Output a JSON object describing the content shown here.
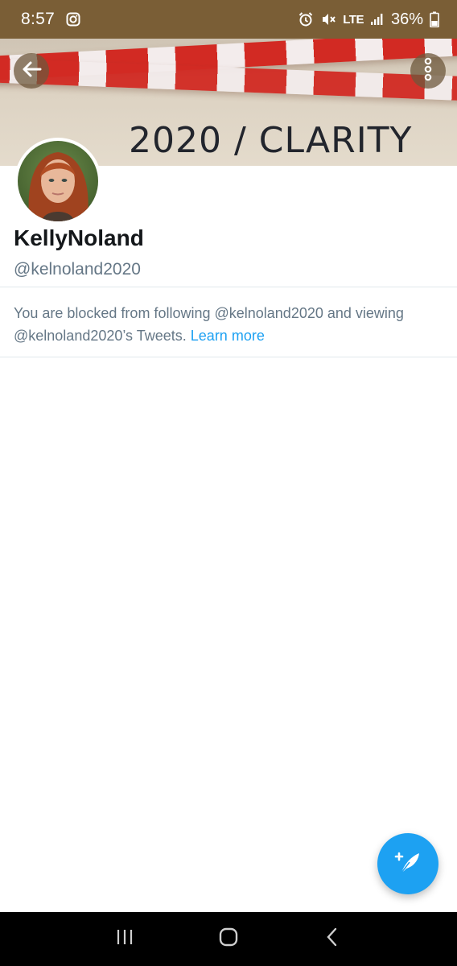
{
  "status_bar": {
    "time": "8:57",
    "battery": "36%",
    "network": "LTE",
    "icons": [
      "instagram-icon",
      "alarm-icon",
      "mute-icon",
      "signal-icon",
      "battery-icon"
    ]
  },
  "banner": {
    "text": "2020 / CLARITY",
    "icons": {
      "back": "back-arrow-icon",
      "more": "more-vertical-icon"
    }
  },
  "profile": {
    "display_name": "KellyNoland",
    "handle": "@kelnoland2020"
  },
  "notice": {
    "text": "You are blocked from following @kelnoland2020 and viewing @kelnoland2020’s Tweets.",
    "link": "Learn more"
  },
  "fab": {
    "icon": "compose-tweet-icon"
  },
  "nav_bar": {
    "icons": [
      "recent-apps-icon",
      "home-icon",
      "back-icon"
    ]
  },
  "colors": {
    "accent": "#1da1f2",
    "status_bar": "#7a5e36",
    "secondary_text": "#657786",
    "primary_text": "#14171a"
  }
}
